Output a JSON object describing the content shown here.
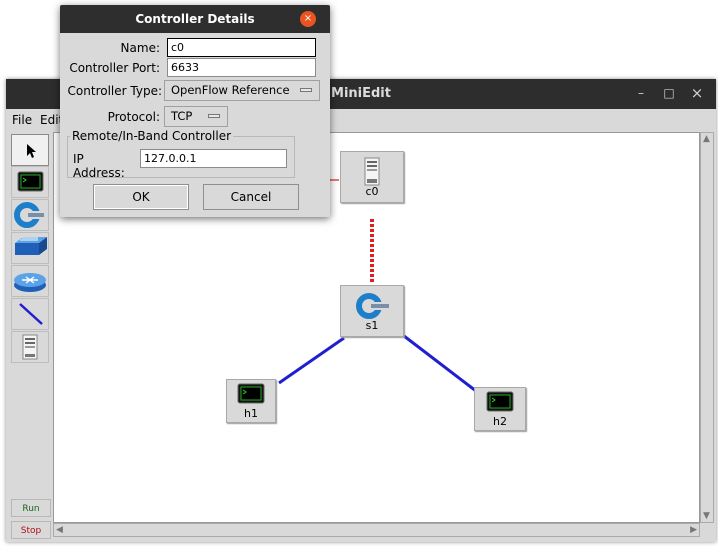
{
  "main_window": {
    "title": "MiniEdit",
    "controls": {
      "minimize": "–",
      "maximize": "□",
      "close": "×"
    },
    "menu": [
      "File",
      "Edit"
    ],
    "toolbar": {
      "tools": [
        "select-tool",
        "host-tool",
        "switch-tool",
        "legacy-switch-tool",
        "legacy-router-tool",
        "link-tool",
        "controller-tool"
      ],
      "run_label": "Run",
      "stop_label": "Stop"
    },
    "nodes": [
      {
        "id": "c0",
        "label": "c0",
        "type": "controller"
      },
      {
        "id": "s1",
        "label": "s1",
        "type": "switch"
      },
      {
        "id": "h1",
        "label": "h1",
        "type": "host"
      },
      {
        "id": "h2",
        "label": "h2",
        "type": "host"
      }
    ]
  },
  "dialog": {
    "title": "Controller Details",
    "close_icon": "×",
    "name_label": "Name:",
    "name_value": "c0",
    "port_label": "Controller Port:",
    "port_value": "6633",
    "type_label": "Controller Type:",
    "type_value": "OpenFlow Reference",
    "protocol_label": "Protocol:",
    "protocol_value": "TCP",
    "group_title": "Remote/In-Band Controller",
    "ip_label": "IP Address:",
    "ip_value": "127.0.0.1",
    "ok_label": "OK",
    "cancel_label": "Cancel"
  },
  "colors": {
    "link_blue": "#1f1fd0",
    "controller_link_red": "#e02020",
    "close_orange": "#e95420",
    "titlebar_dark": "#2d2d2d"
  }
}
